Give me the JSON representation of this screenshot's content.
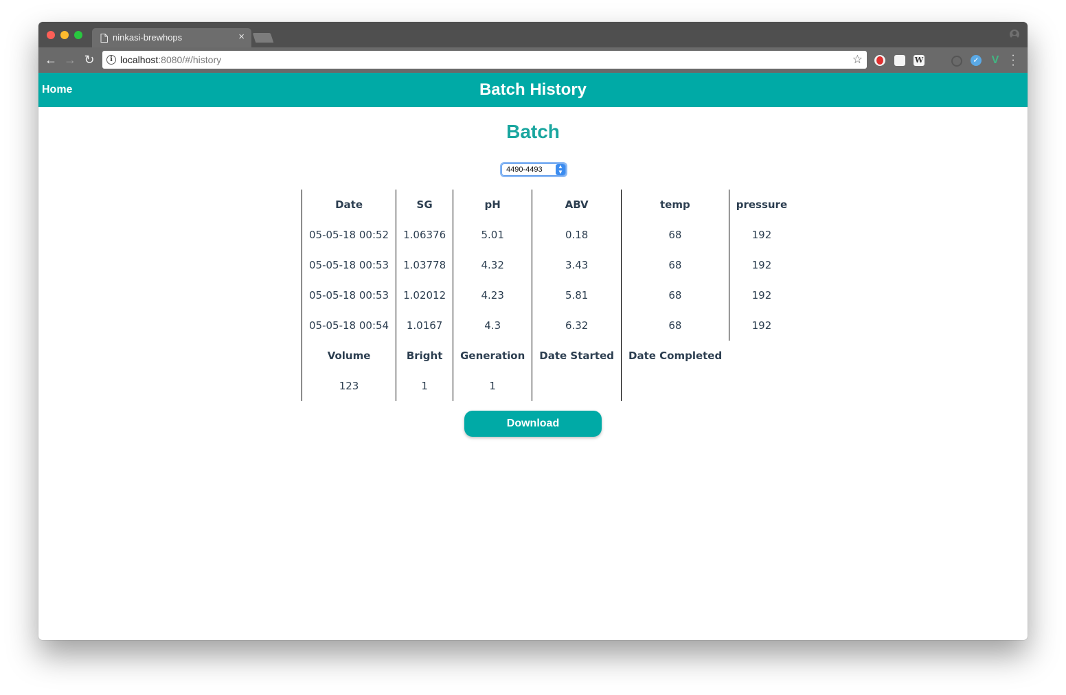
{
  "browser": {
    "tab_title": "ninkasi-brewhops",
    "tab_close": "×",
    "url_host": "localhost",
    "url_rest": ":8080/#/history",
    "back": "←",
    "forward": "→",
    "reload": "↻",
    "star": "☆",
    "ext_w": "W",
    "ext_vue": "V",
    "ext_blue": "✓",
    "menu": "⋮"
  },
  "header": {
    "home_label": "Home",
    "title": "Batch History"
  },
  "main": {
    "heading": "Batch",
    "batch_select": {
      "value": "4490-4493"
    },
    "readings": {
      "columns": [
        "Date",
        "SG",
        "pH",
        "ABV",
        "temp",
        "pressure"
      ],
      "rows": [
        [
          "05-05-18 00:52",
          "1.06376",
          "5.01",
          "0.18",
          "68",
          "192"
        ],
        [
          "05-05-18 00:53",
          "1.03778",
          "4.32",
          "3.43",
          "68",
          "192"
        ],
        [
          "05-05-18 00:53",
          "1.02012",
          "4.23",
          "5.81",
          "68",
          "192"
        ],
        [
          "05-05-18 00:54",
          "1.0167",
          "4.3",
          "6.32",
          "68",
          "192"
        ]
      ]
    },
    "details": {
      "columns": [
        "Volume",
        "Bright",
        "Generation",
        "Date Started",
        "Date Completed"
      ],
      "values": [
        "123",
        "1",
        "1",
        "",
        ""
      ]
    },
    "download_label": "Download"
  },
  "colors": {
    "brand": "#00aaa6",
    "heading": "#1aa69f",
    "text": "#2c3e50"
  }
}
